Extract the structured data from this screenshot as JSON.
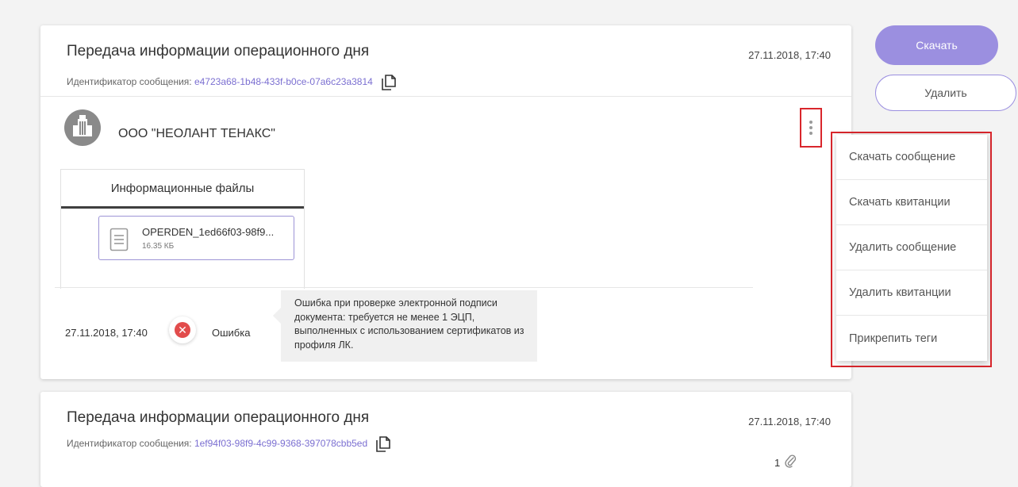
{
  "messages": [
    {
      "title": "Передача информации операционного дня",
      "date": "27.11.2018, 17:40",
      "id_label": "Идентификатор сообщения:",
      "id_value": "e4723a68-1b48-433f-b0ce-07a6c23a3814",
      "org_name": "ООО \"НЕОЛАНТ ТЕНАКС\"",
      "files_tab": "Информационные файлы",
      "file": {
        "name": "OPERDEN_1ed66f03-98f9...",
        "size": "16.35 КБ"
      },
      "status": {
        "date": "27.11.2018, 17:40",
        "label": "Ошибка",
        "message": "Ошибка при проверке электронной подписи документа: требуется не менее 1 ЭЦП, выполненных с использованием сертификатов из профиля ЛК."
      }
    },
    {
      "title": "Передача информации операционного дня",
      "date": "27.11.2018, 17:40",
      "id_label": "Идентификатор сообщения:",
      "id_value": "1ef94f03-98f9-4c99-9368-397078cbb5ed",
      "attachments_count": "1"
    }
  ],
  "actions": {
    "download": "Скачать",
    "delete": "Удалить"
  },
  "context_menu": [
    "Скачать сообщение",
    "Скачать квитанции",
    "Удалить сообщение",
    "Удалить квитанции",
    "Прикрепить теги"
  ],
  "icons": {
    "copy": "copy-icon",
    "org": "building-icon",
    "more": "kebab-menu-icon",
    "file": "document-icon",
    "error": "error-x-icon",
    "attachment": "paperclip-icon"
  },
  "colors": {
    "accent": "#9b8fe0",
    "link": "#7b6fd1",
    "error": "#e24c4c",
    "highlight": "#d9262c"
  }
}
